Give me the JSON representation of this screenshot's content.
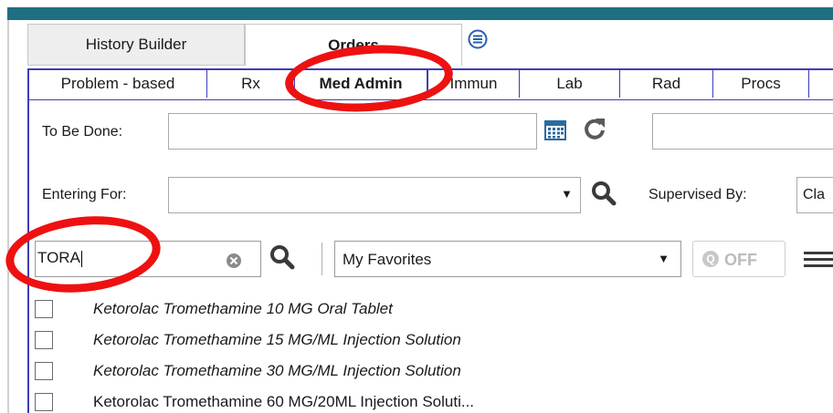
{
  "top_tabs": [
    {
      "label": "History Builder"
    },
    {
      "label": "Orders"
    }
  ],
  "sub_tabs": [
    {
      "label": "Problem - based"
    },
    {
      "label": "Rx"
    },
    {
      "label": "Med Admin"
    },
    {
      "label": "Immun"
    },
    {
      "label": "Lab"
    },
    {
      "label": "Rad"
    },
    {
      "label": "Procs"
    }
  ],
  "form": {
    "to_be_done_label": "To Be Done:",
    "to_be_done_value": "",
    "entering_for_label": "Entering For:",
    "entering_for_value": "",
    "supervised_by_label": "Supervised By:",
    "supervised_by_value": "Cla"
  },
  "search": {
    "value": "TORA",
    "favorites_value": "My Favorites",
    "off_label": "OFF",
    "q_label": "Q"
  },
  "results": [
    {
      "label": "Ketorolac Tromethamine 10 MG Oral Tablet",
      "italic": true
    },
    {
      "label": "Ketorolac Tromethamine 15 MG/ML Injection Solution",
      "italic": true
    },
    {
      "label": "Ketorolac Tromethamine 30 MG/ML Injection Solution",
      "italic": true
    },
    {
      "label": "Ketorolac Tromethamine 60 MG/20ML Injection Soluti...",
      "italic": false
    }
  ],
  "colors": {
    "top_strip": "#1f6f82",
    "tab_border": "#3d3db8",
    "annotation": "#ee1111"
  }
}
